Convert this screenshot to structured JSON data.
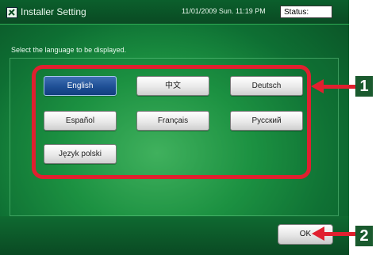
{
  "window": {
    "title": "Installer Setting",
    "datetime": "11/01/2009 Sun. 11:19 PM",
    "status_label": "Status:"
  },
  "main": {
    "instruction": "Select the language to be displayed.",
    "languages": [
      {
        "label": "English",
        "selected": true
      },
      {
        "label": "中文",
        "selected": false
      },
      {
        "label": "Deutsch",
        "selected": false
      },
      {
        "label": "Español",
        "selected": false
      },
      {
        "label": "Français",
        "selected": false
      },
      {
        "label": "Русский",
        "selected": false
      },
      {
        "label": "Język polski",
        "selected": false
      }
    ]
  },
  "footer": {
    "ok_label": "OK"
  },
  "callouts": [
    {
      "number": "1"
    },
    {
      "number": "2"
    }
  ],
  "colors": {
    "highlight": "#e0202f",
    "selected_button": "#1e4f95",
    "screen_green": "#1f9a45"
  },
  "icons": {
    "app": "installer-icon"
  }
}
